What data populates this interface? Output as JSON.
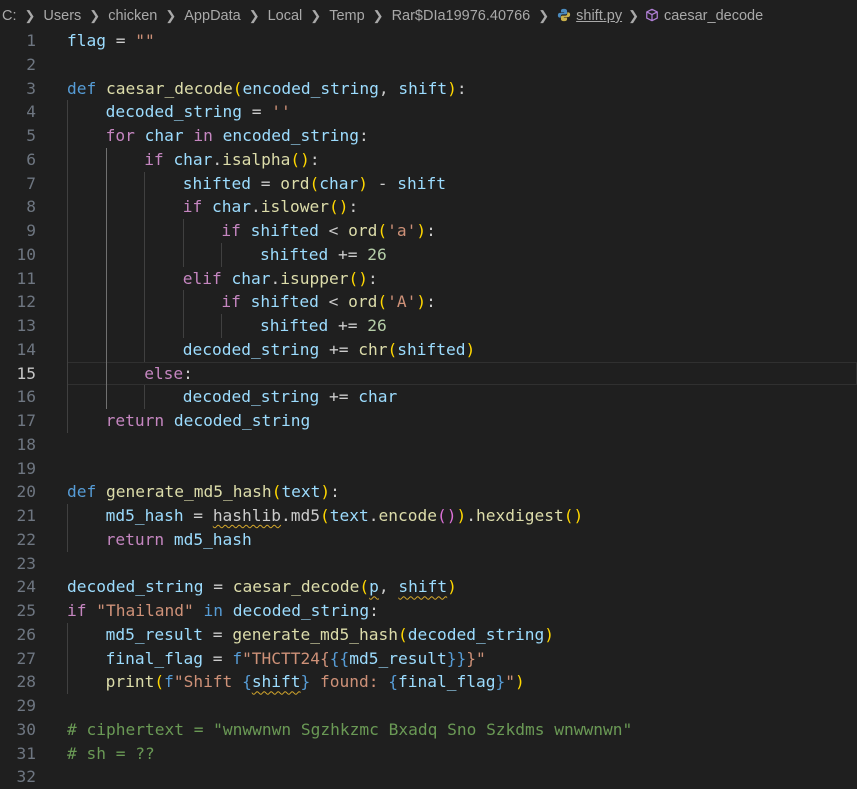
{
  "breadcrumb": {
    "segments": [
      "C:",
      "Users",
      "chicken",
      "AppData",
      "Local",
      "Temp",
      "Rar$DIa19976.40766"
    ],
    "file": "shift.py",
    "symbol": "caesar_decode",
    "file_icon": "python-icon",
    "symbol_icon": "method-cube-icon"
  },
  "colors": {
    "keyword": "#569cd6",
    "control": "#c586c0",
    "function": "#dcdcaa",
    "variable": "#9cdcfe",
    "string": "#ce9178",
    "number": "#b5cea8",
    "comment": "#6a9955",
    "bracket1": "#ffd700",
    "bracket2": "#da70d6",
    "bracket3": "#179fff"
  },
  "lines": [
    {
      "n": "1",
      "indent": 0,
      "tokens": [
        [
          "flag",
          "v"
        ],
        [
          " = ",
          ""
        ],
        [
          "\"\"",
          "s"
        ]
      ]
    },
    {
      "n": "2",
      "indent": 0,
      "tokens": []
    },
    {
      "n": "3",
      "indent": 0,
      "tokens": [
        [
          "def",
          "k"
        ],
        [
          " ",
          ""
        ],
        [
          "caesar_decode",
          "f"
        ],
        [
          "(",
          "b1"
        ],
        [
          "encoded_string",
          "v"
        ],
        [
          ", ",
          ""
        ],
        [
          "shift",
          "v"
        ],
        [
          ")",
          "b1"
        ],
        [
          ":",
          ""
        ]
      ]
    },
    {
      "n": "4",
      "indent": 1,
      "tokens": [
        [
          "decoded_string",
          "v"
        ],
        [
          " = ",
          ""
        ],
        [
          "''",
          "s"
        ]
      ]
    },
    {
      "n": "5",
      "indent": 1,
      "tokens": [
        [
          "for",
          "c"
        ],
        [
          " ",
          ""
        ],
        [
          "char",
          "v"
        ],
        [
          " ",
          ""
        ],
        [
          "in",
          "c"
        ],
        [
          " ",
          ""
        ],
        [
          "encoded_string",
          "v"
        ],
        [
          ":",
          ""
        ]
      ]
    },
    {
      "n": "6",
      "indent": 2,
      "tokens": [
        [
          "if",
          "c"
        ],
        [
          " ",
          ""
        ],
        [
          "char",
          "v"
        ],
        [
          ".",
          ""
        ],
        [
          "isalpha",
          "f"
        ],
        [
          "()",
          "b1"
        ],
        [
          ":",
          ""
        ]
      ]
    },
    {
      "n": "7",
      "indent": 3,
      "tokens": [
        [
          "shifted",
          "v"
        ],
        [
          " = ",
          ""
        ],
        [
          "ord",
          "f"
        ],
        [
          "(",
          "b1"
        ],
        [
          "char",
          "v"
        ],
        [
          ")",
          "b1"
        ],
        [
          " - ",
          ""
        ],
        [
          "shift",
          "v"
        ]
      ]
    },
    {
      "n": "8",
      "indent": 3,
      "tokens": [
        [
          "if",
          "c"
        ],
        [
          " ",
          ""
        ],
        [
          "char",
          "v"
        ],
        [
          ".",
          ""
        ],
        [
          "islower",
          "f"
        ],
        [
          "()",
          "b1"
        ],
        [
          ":",
          ""
        ]
      ]
    },
    {
      "n": "9",
      "indent": 4,
      "tokens": [
        [
          "if",
          "c"
        ],
        [
          " ",
          ""
        ],
        [
          "shifted",
          "v"
        ],
        [
          " < ",
          ""
        ],
        [
          "ord",
          "f"
        ],
        [
          "(",
          "b1"
        ],
        [
          "'a'",
          "s"
        ],
        [
          ")",
          "b1"
        ],
        [
          ":",
          ""
        ]
      ]
    },
    {
      "n": "10",
      "indent": 5,
      "tokens": [
        [
          "shifted",
          "v"
        ],
        [
          " += ",
          ""
        ],
        [
          "26",
          "n"
        ]
      ]
    },
    {
      "n": "11",
      "indent": 3,
      "tokens": [
        [
          "elif",
          "c"
        ],
        [
          " ",
          ""
        ],
        [
          "char",
          "v"
        ],
        [
          ".",
          ""
        ],
        [
          "isupper",
          "f"
        ],
        [
          "()",
          "b1"
        ],
        [
          ":",
          ""
        ]
      ]
    },
    {
      "n": "12",
      "indent": 4,
      "tokens": [
        [
          "if",
          "c"
        ],
        [
          " ",
          ""
        ],
        [
          "shifted",
          "v"
        ],
        [
          " < ",
          ""
        ],
        [
          "ord",
          "f"
        ],
        [
          "(",
          "b1"
        ],
        [
          "'A'",
          "s"
        ],
        [
          ")",
          "b1"
        ],
        [
          ":",
          ""
        ]
      ]
    },
    {
      "n": "13",
      "indent": 5,
      "tokens": [
        [
          "shifted",
          "v"
        ],
        [
          " += ",
          ""
        ],
        [
          "26",
          "n"
        ]
      ]
    },
    {
      "n": "14",
      "indent": 3,
      "tokens": [
        [
          "decoded_string",
          "v"
        ],
        [
          " += ",
          ""
        ],
        [
          "chr",
          "f"
        ],
        [
          "(",
          "b1"
        ],
        [
          "shifted",
          "v"
        ],
        [
          ")",
          "b1"
        ]
      ]
    },
    {
      "n": "15",
      "indent": 2,
      "current": true,
      "tokens": [
        [
          "else",
          "c"
        ],
        [
          ":",
          ""
        ]
      ]
    },
    {
      "n": "16",
      "indent": 3,
      "tokens": [
        [
          "decoded_string",
          "v"
        ],
        [
          " += ",
          ""
        ],
        [
          "char",
          "v"
        ]
      ]
    },
    {
      "n": "17",
      "indent": 1,
      "tokens": [
        [
          "return",
          "c"
        ],
        [
          " ",
          ""
        ],
        [
          "decoded_string",
          "v"
        ]
      ]
    },
    {
      "n": "18",
      "indent": 0,
      "tokens": []
    },
    {
      "n": "19",
      "indent": 0,
      "tokens": []
    },
    {
      "n": "20",
      "indent": 0,
      "tokens": [
        [
          "def",
          "k"
        ],
        [
          " ",
          ""
        ],
        [
          "generate_md5_hash",
          "f"
        ],
        [
          "(",
          "b1"
        ],
        [
          "text",
          "v"
        ],
        [
          ")",
          "b1"
        ],
        [
          ":",
          ""
        ]
      ]
    },
    {
      "n": "21",
      "indent": 1,
      "tokens": [
        [
          "md5_hash",
          "v"
        ],
        [
          " = ",
          ""
        ],
        [
          "hashlib",
          "w"
        ],
        [
          ".md5",
          ""
        ],
        [
          "(",
          "b1"
        ],
        [
          "text",
          "v"
        ],
        [
          ".",
          ""
        ],
        [
          "encode",
          "f"
        ],
        [
          "()",
          "b2"
        ],
        [
          ")",
          "b1"
        ],
        [
          ".",
          ""
        ],
        [
          "hexdigest",
          "f"
        ],
        [
          "()",
          "b1"
        ]
      ]
    },
    {
      "n": "22",
      "indent": 1,
      "tokens": [
        [
          "return",
          "c"
        ],
        [
          " ",
          ""
        ],
        [
          "md5_hash",
          "v"
        ]
      ]
    },
    {
      "n": "23",
      "indent": 0,
      "tokens": []
    },
    {
      "n": "24",
      "indent": 0,
      "tokens": [
        [
          "decoded_string",
          "v"
        ],
        [
          " = ",
          ""
        ],
        [
          "caesar_decode",
          "f"
        ],
        [
          "(",
          "b1"
        ],
        [
          "p",
          "vw"
        ],
        [
          ", ",
          ""
        ],
        [
          "shift",
          "vw"
        ],
        [
          ")",
          "b1"
        ]
      ]
    },
    {
      "n": "25",
      "indent": 0,
      "tokens": [
        [
          "if",
          "c"
        ],
        [
          " ",
          ""
        ],
        [
          "\"Thailand\"",
          "s"
        ],
        [
          " ",
          ""
        ],
        [
          "in",
          "k"
        ],
        [
          " ",
          ""
        ],
        [
          "decoded_string",
          "v"
        ],
        [
          ":",
          ""
        ]
      ]
    },
    {
      "n": "26",
      "indent": 1,
      "tokens": [
        [
          "md5_result",
          "v"
        ],
        [
          " = ",
          ""
        ],
        [
          "generate_md5_hash",
          "f"
        ],
        [
          "(",
          "b1"
        ],
        [
          "decoded_string",
          "v"
        ],
        [
          ")",
          "b1"
        ]
      ]
    },
    {
      "n": "27",
      "indent": 1,
      "tokens": [
        [
          "final_flag",
          "v"
        ],
        [
          " = ",
          ""
        ],
        [
          "f",
          "k"
        ],
        [
          "\"THCTT24{",
          "s"
        ],
        [
          "{{",
          "kb"
        ],
        [
          "md5_result",
          "v"
        ],
        [
          "}}",
          "kb"
        ],
        [
          "}\"",
          "s"
        ]
      ]
    },
    {
      "n": "28",
      "indent": 1,
      "tokens": [
        [
          "print",
          "f"
        ],
        [
          "(",
          "b1"
        ],
        [
          "f",
          "k"
        ],
        [
          "\"Shift ",
          "s"
        ],
        [
          "{",
          "kb"
        ],
        [
          "shift",
          "vw"
        ],
        [
          "}",
          "kb"
        ],
        [
          " found: ",
          "s"
        ],
        [
          "{",
          "kb"
        ],
        [
          "final_flag",
          "v"
        ],
        [
          "}",
          "kb"
        ],
        [
          "\"",
          "s"
        ],
        [
          ")",
          "b1"
        ]
      ]
    },
    {
      "n": "29",
      "indent": 0,
      "tokens": []
    },
    {
      "n": "30",
      "indent": 0,
      "tokens": [
        [
          "# ciphertext = \"wnwwnwn Sgzhkzmc Bxadq Sno Szkdms wnwwnwn\"",
          "o"
        ]
      ]
    },
    {
      "n": "31",
      "indent": 0,
      "tokens": [
        [
          "# sh = ??",
          "o"
        ]
      ]
    },
    {
      "n": "32",
      "indent": 0,
      "tokens": []
    }
  ]
}
